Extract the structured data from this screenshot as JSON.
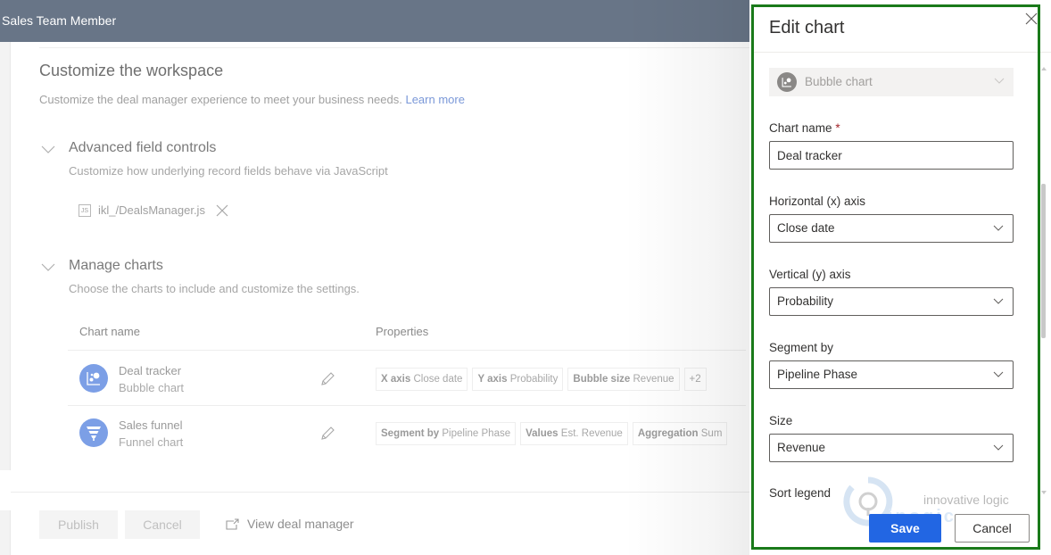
{
  "app": {
    "role_title": "Sales Team Member"
  },
  "page": {
    "title": "Customize the workspace",
    "subtitle": "Customize the deal manager experience to meet your business needs.",
    "learn_more": "Learn more"
  },
  "sections": {
    "advanced": {
      "title": "Advanced field controls",
      "subtitle": "Customize how underlying record fields behave via JavaScript",
      "file_icon_text": "JS",
      "file_name": "ikl_/DealsManager.js"
    },
    "charts": {
      "title": "Manage charts",
      "subtitle": "Choose the charts to include and customize the settings.",
      "columns": {
        "name": "Chart name",
        "properties": "Properties"
      },
      "rows": [
        {
          "name": "Deal tracker",
          "type": "Bubble chart",
          "icon": "bubble-chart-icon",
          "chips": [
            {
              "key": "X axis",
              "value": "Close date"
            },
            {
              "key": "Y axis",
              "value": "Probability"
            },
            {
              "key": "Bubble size",
              "value": "Revenue"
            },
            {
              "key": "",
              "value": "+2"
            }
          ]
        },
        {
          "name": "Sales funnel",
          "type": "Funnel chart",
          "icon": "funnel-chart-icon",
          "chips": [
            {
              "key": "Segment by",
              "value": "Pipeline Phase"
            },
            {
              "key": "Values",
              "value": "Est. Revenue"
            },
            {
              "key": "Aggregation",
              "value": "Sum"
            }
          ]
        }
      ]
    }
  },
  "footer": {
    "publish": "Publish",
    "cancel": "Cancel",
    "view_link": "View deal manager"
  },
  "panel": {
    "title": "Edit chart",
    "chart_type": "Bubble chart",
    "fields": {
      "chart_name": {
        "label": "Chart name",
        "required_mark": "*",
        "value": "Deal tracker"
      },
      "x_axis": {
        "label": "Horizontal (x) axis",
        "value": "Close date"
      },
      "y_axis": {
        "label": "Vertical (y) axis",
        "value": "Probability"
      },
      "segment_by": {
        "label": "Segment by",
        "value": "Pipeline Phase"
      },
      "size": {
        "label": "Size",
        "value": "Revenue"
      },
      "sort_legend": {
        "label": "Sort legend"
      }
    },
    "save": "Save",
    "cancel": "Cancel"
  },
  "watermark": {
    "tagline": "innovative logic",
    "brand": "inogic"
  },
  "colors": {
    "accent": "#2266e3",
    "header": "#687587",
    "chart_icon": "#7c9fe6",
    "highlight_outline": "#1a7a1a",
    "required": "#a4262c"
  }
}
